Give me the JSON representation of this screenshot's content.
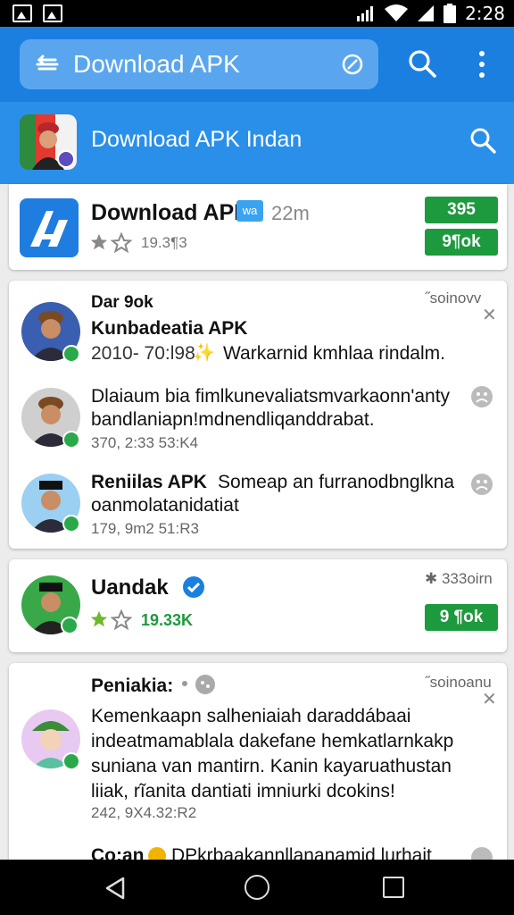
{
  "status_bar": {
    "time": "2:28"
  },
  "app_bar": {
    "search_text": "Download APK"
  },
  "app_strip": {
    "title": "Download APK Indan"
  },
  "card1": {
    "title": "Download APK",
    "badge": "wa",
    "time": "22m",
    "rating": "19.3¶3",
    "top_button": "395",
    "bottom_button": "9¶ok"
  },
  "card2": {
    "timestamp": "˝soinovv",
    "items": [
      {
        "line1": "Dar 9ok",
        "line2": "Kunbadeatia APK",
        "line3": "2010- 70:l98",
        "line3b": "Warkarnid kmhlaa rindalm."
      },
      {
        "line1": "Dlaiaum bia fimlkunevaliatsmvarkaonn'anty",
        "line2": "bandlaniapn!mdnendliqanddrabat.",
        "meta": "370, 2:33 53:K4"
      },
      {
        "line1": "Reniilas APK",
        "line1b": "Someap an furranodbnglkna",
        "line2": "oanmolatanidatiat",
        "meta": "179, 9m2 51:R3"
      }
    ]
  },
  "card3": {
    "title": "Uandak",
    "timestamp": "✱ 333oirn",
    "rating": "19.33K",
    "button": "9 ¶ok"
  },
  "card4": {
    "title": "Peniakia:",
    "timestamp": "˝soinoanu",
    "body": [
      "Kemenkaapn salheniaiah daraddábaai",
      "indeatmamablala dakefane hemkatlarnkakp",
      "suniana van mantirn. Kanin kayaruathustan",
      "liiak, rĩanita dantiati imniurki dcokins!"
    ],
    "meta": "242, 9X4.32:R2",
    "footer": "Co:an",
    "footer2": "DPkrbaakannllananamid lurhait"
  },
  "colors": {
    "primary": "#1b7fe0",
    "green": "#1e9a3e",
    "star": "#6db82b"
  }
}
